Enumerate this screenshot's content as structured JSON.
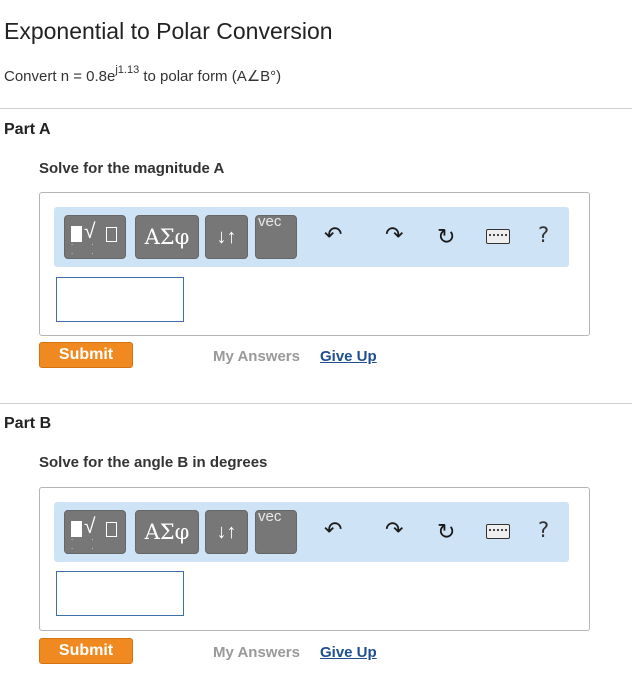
{
  "title": "Exponential to Polar Conversion",
  "problem": {
    "prefix": "Convert n = 0.8e",
    "exponent": "j1.13",
    "suffix": " to polar form (A∠B°)"
  },
  "parts": [
    {
      "label": "Part A",
      "instruction": "Solve for the magnitude A",
      "answer_value": "",
      "submit_label": "Submit",
      "my_answers_label": "My Answers",
      "give_up_label": "Give Up"
    },
    {
      "label": "Part B",
      "instruction": "Solve for the angle B in degrees",
      "answer_value": "",
      "submit_label": "Submit",
      "my_answers_label": "My Answers",
      "give_up_label": "Give Up"
    }
  ],
  "toolbar": {
    "templates_glyph": "√",
    "symbols_label": "ΑΣφ",
    "arrows_label": "↓↑",
    "vector_label": "vec",
    "undo_icon": "undo-icon",
    "redo_icon": "redo-icon",
    "reset_icon": "reset-icon",
    "keyboard_icon": "keyboard-icon",
    "help_label": "?"
  },
  "colors": {
    "submit": "#f0891f",
    "toolbar_bg": "#cfe3f7",
    "link": "#1d4f91",
    "muted": "#999999"
  }
}
